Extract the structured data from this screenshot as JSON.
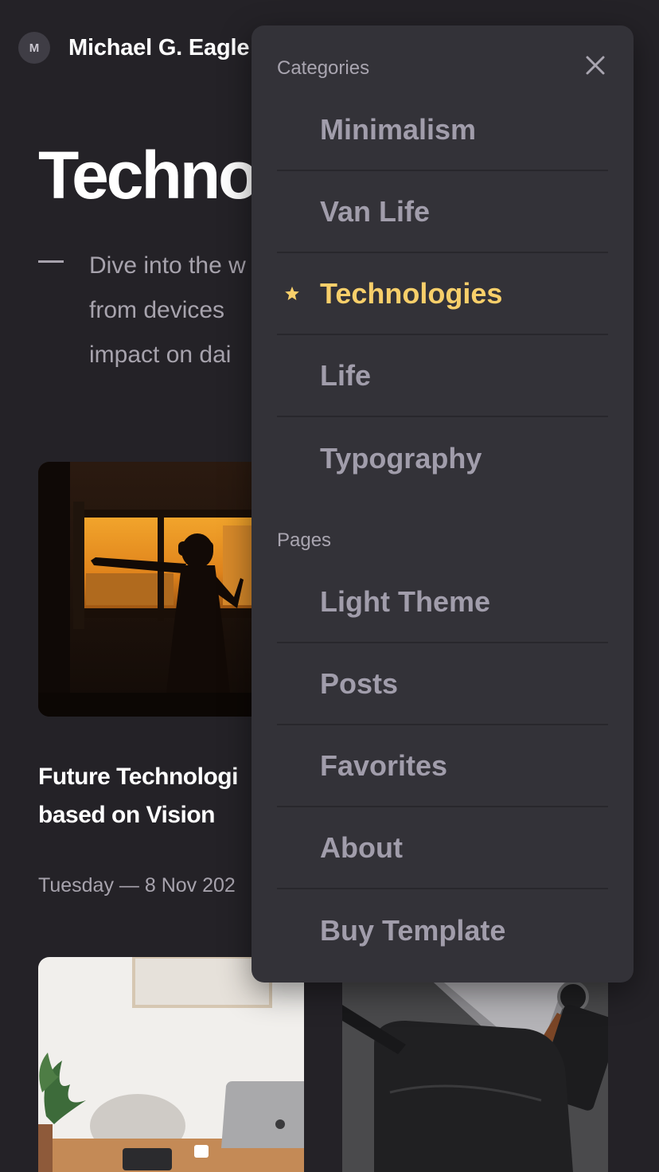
{
  "header": {
    "avatar_initial": "M",
    "site_name": "Michael G. Eagle"
  },
  "hero": {
    "title": "Techno",
    "description_lines": [
      "Dive into the w",
      "from devices",
      "impact on dai"
    ]
  },
  "cards": [
    {
      "title_lines": [
        "Future Technologi",
        "based on Vision"
      ],
      "meta": "Tuesday — 8 Nov 202"
    }
  ],
  "menu": {
    "categories_heading": "Categories",
    "pages_heading": "Pages",
    "close_icon": "close-icon",
    "active_star_icon": "star-icon",
    "categories": [
      {
        "label": "Minimalism",
        "active": false
      },
      {
        "label": "Van Life",
        "active": false
      },
      {
        "label": "Technologies",
        "active": true
      },
      {
        "label": "Life",
        "active": false
      },
      {
        "label": "Typography",
        "active": false
      }
    ],
    "pages": [
      {
        "label": "Light Theme"
      },
      {
        "label": "Posts"
      },
      {
        "label": "Favorites"
      },
      {
        "label": "About"
      },
      {
        "label": "Buy Template"
      }
    ]
  },
  "colors": {
    "background": "#242227",
    "menu_background": "#333238",
    "accent": "#f8cf6a",
    "muted_text": "#a19dab"
  }
}
